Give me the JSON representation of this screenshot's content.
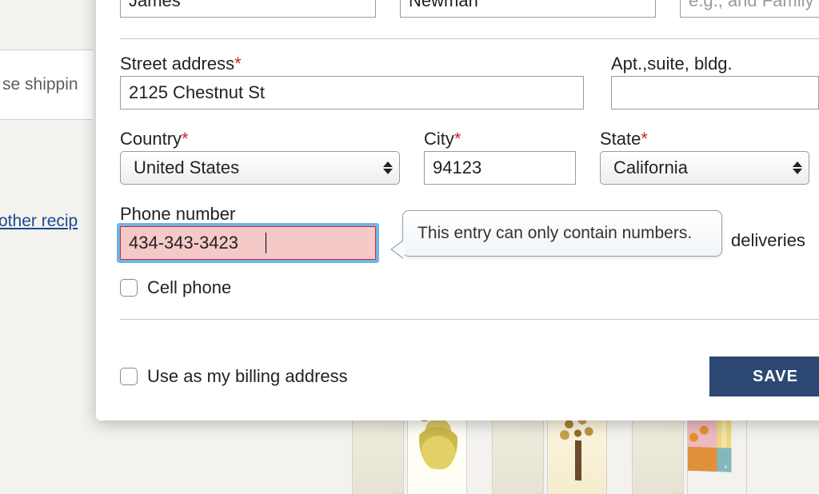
{
  "background": {
    "tab_label": "se shippin",
    "link_label": "other recip"
  },
  "form": {
    "name": {
      "first_value": "James",
      "last_value": "Newman",
      "suffix_placeholder": "e.g., and Family"
    },
    "street": {
      "label": "Street address",
      "value": "2125 Chestnut St"
    },
    "apt": {
      "label": "Apt.,suite, bldg.",
      "value": ""
    },
    "country": {
      "label": "Country",
      "value": "United States"
    },
    "city": {
      "label": "City",
      "value": "94123"
    },
    "state": {
      "label": "State",
      "value": "California"
    },
    "phone": {
      "label": "Phone number",
      "value": "434-343-3423",
      "error": "This entry can only contain numbers.",
      "trailing_text": "deliveries"
    },
    "cell_checkbox_label": "Cell phone",
    "billing_checkbox_label": "Use as my billing address",
    "save_label": "SAVE"
  },
  "required_marker": "*"
}
